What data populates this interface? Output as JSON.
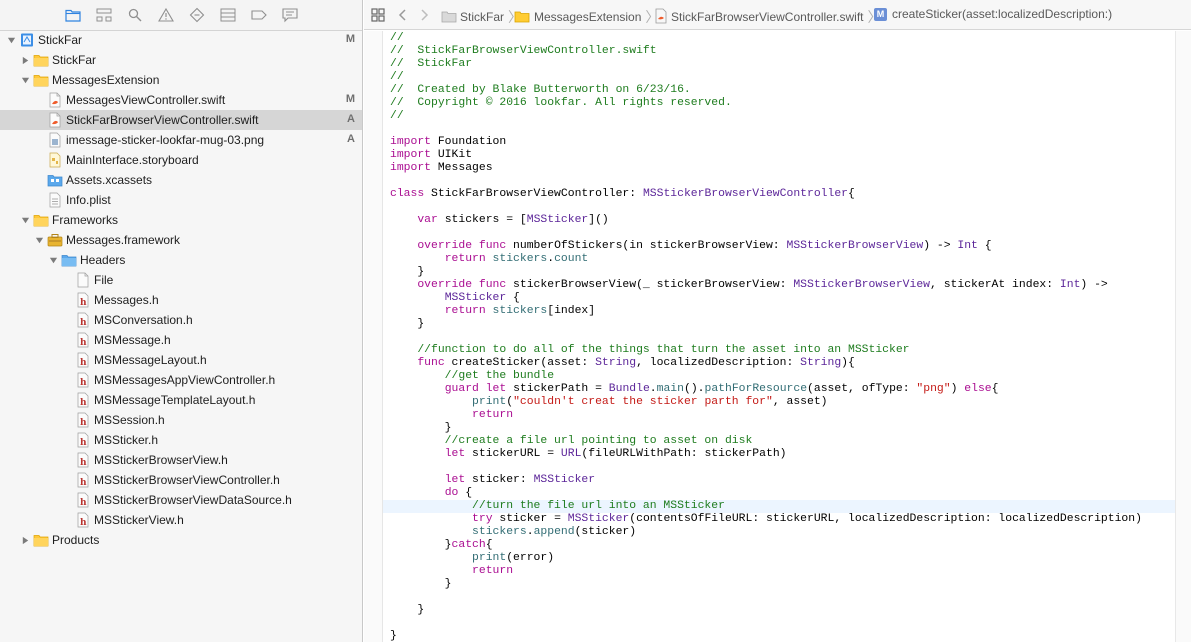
{
  "navigator": {
    "toolbar_icons": [
      "folder-icon",
      "hierarchy-icon",
      "search-icon",
      "warning-icon",
      "test-diamond-icon",
      "debug-grid-icon",
      "breakpoint-icon",
      "report-icon"
    ],
    "tree": [
      {
        "label": "StickFar",
        "badge": "M",
        "icon": "project-icon",
        "indent": 0,
        "disclosure": "open"
      },
      {
        "label": "StickFar",
        "badge": "",
        "icon": "folder-icon",
        "indent": 1,
        "disclosure": "closed"
      },
      {
        "label": "MessagesExtension",
        "badge": "",
        "icon": "folder-icon",
        "indent": 1,
        "disclosure": "open"
      },
      {
        "label": "MessagesViewController.swift",
        "badge": "M",
        "icon": "swift-file-icon",
        "indent": 2,
        "disclosure": ""
      },
      {
        "label": "StickFarBrowserViewController.swift",
        "badge": "A",
        "icon": "swift-file-icon",
        "indent": 2,
        "disclosure": "",
        "selected": true
      },
      {
        "label": "imessage-sticker-lookfar-mug-03.png",
        "badge": "A",
        "icon": "image-file-icon",
        "indent": 2,
        "disclosure": ""
      },
      {
        "label": "MainInterface.storyboard",
        "badge": "",
        "icon": "storyboard-icon",
        "indent": 2,
        "disclosure": ""
      },
      {
        "label": "Assets.xcassets",
        "badge": "",
        "icon": "assets-folder-icon",
        "indent": 2,
        "disclosure": ""
      },
      {
        "label": "Info.plist",
        "badge": "",
        "icon": "plist-file-icon",
        "indent": 2,
        "disclosure": ""
      },
      {
        "label": "Frameworks",
        "badge": "",
        "icon": "folder-icon",
        "indent": 1,
        "disclosure": "open"
      },
      {
        "label": "Messages.framework",
        "badge": "",
        "icon": "framework-icon",
        "indent": 2,
        "disclosure": "open"
      },
      {
        "label": "Headers",
        "badge": "",
        "icon": "blue-folder-icon",
        "indent": 3,
        "disclosure": "open"
      },
      {
        "label": "File",
        "badge": "",
        "icon": "blank-file-icon",
        "indent": 4,
        "disclosure": ""
      },
      {
        "label": "Messages.h",
        "badge": "",
        "icon": "header-file-icon",
        "indent": 4,
        "disclosure": ""
      },
      {
        "label": "MSConversation.h",
        "badge": "",
        "icon": "header-file-icon",
        "indent": 4,
        "disclosure": ""
      },
      {
        "label": "MSMessage.h",
        "badge": "",
        "icon": "header-file-icon",
        "indent": 4,
        "disclosure": ""
      },
      {
        "label": "MSMessageLayout.h",
        "badge": "",
        "icon": "header-file-icon",
        "indent": 4,
        "disclosure": ""
      },
      {
        "label": "MSMessagesAppViewController.h",
        "badge": "",
        "icon": "header-file-icon",
        "indent": 4,
        "disclosure": ""
      },
      {
        "label": "MSMessageTemplateLayout.h",
        "badge": "",
        "icon": "header-file-icon",
        "indent": 4,
        "disclosure": ""
      },
      {
        "label": "MSSession.h",
        "badge": "",
        "icon": "header-file-icon",
        "indent": 4,
        "disclosure": ""
      },
      {
        "label": "MSSticker.h",
        "badge": "",
        "icon": "header-file-icon",
        "indent": 4,
        "disclosure": ""
      },
      {
        "label": "MSStickerBrowserView.h",
        "badge": "",
        "icon": "header-file-icon",
        "indent": 4,
        "disclosure": ""
      },
      {
        "label": "MSStickerBrowserViewController.h",
        "badge": "",
        "icon": "header-file-icon",
        "indent": 4,
        "disclosure": ""
      },
      {
        "label": "MSStickerBrowserViewDataSource.h",
        "badge": "",
        "icon": "header-file-icon",
        "indent": 4,
        "disclosure": ""
      },
      {
        "label": "MSStickerView.h",
        "badge": "",
        "icon": "header-file-icon",
        "indent": 4,
        "disclosure": ""
      },
      {
        "label": "Products",
        "badge": "",
        "icon": "folder-icon",
        "indent": 1,
        "disclosure": "closed"
      }
    ]
  },
  "jump_bar": {
    "crumbs": [
      "StickFar",
      "MessagesExtension",
      "StickFarBrowserViewController.swift",
      "createSticker(asset:localizedDescription:)"
    ],
    "method_badge": "M"
  },
  "code": {
    "current_line_index": 36,
    "lines": [
      [
        [
          "//",
          "comment"
        ]
      ],
      [
        [
          "//  StickFarBrowserViewController.swift",
          "comment"
        ]
      ],
      [
        [
          "//  StickFar",
          "comment"
        ]
      ],
      [
        [
          "//",
          "comment"
        ]
      ],
      [
        [
          "//  Created by Blake Butterworth on 6/23/16.",
          "comment"
        ]
      ],
      [
        [
          "//  Copyright © 2016 lookfar. All rights reserved.",
          "comment"
        ]
      ],
      [
        [
          "//",
          "comment"
        ]
      ],
      [],
      [
        [
          "import",
          "kw"
        ],
        [
          " Foundation",
          "plain"
        ]
      ],
      [
        [
          "import",
          "kw"
        ],
        [
          " UIKit",
          "plain"
        ]
      ],
      [
        [
          "import",
          "kw"
        ],
        [
          " Messages",
          "plain"
        ]
      ],
      [],
      [
        [
          "class",
          "kw"
        ],
        [
          " StickFarBrowserViewController: ",
          "plain"
        ],
        [
          "MSStickerBrowserViewController",
          "type"
        ],
        [
          "{",
          "plain"
        ]
      ],
      [],
      [
        [
          "    ",
          "plain"
        ],
        [
          "var",
          "kw"
        ],
        [
          " stickers = [",
          "plain"
        ],
        [
          "MSSticker",
          "type"
        ],
        [
          "]()",
          "plain"
        ]
      ],
      [],
      [
        [
          "    ",
          "plain"
        ],
        [
          "override",
          "kw"
        ],
        [
          " ",
          "plain"
        ],
        [
          "func",
          "kw"
        ],
        [
          " numberOfStickers(in stickerBrowserView: ",
          "plain"
        ],
        [
          "MSStickerBrowserView",
          "type"
        ],
        [
          ") -> ",
          "plain"
        ],
        [
          "Int",
          "type"
        ],
        [
          " {",
          "plain"
        ]
      ],
      [
        [
          "        ",
          "plain"
        ],
        [
          "return",
          "kw"
        ],
        [
          " ",
          "plain"
        ],
        [
          "stickers",
          "func"
        ],
        [
          ".",
          "plain"
        ],
        [
          "count",
          "func"
        ]
      ],
      [
        [
          "    }",
          "plain"
        ]
      ],
      [
        [
          "    ",
          "plain"
        ],
        [
          "override",
          "kw"
        ],
        [
          " ",
          "plain"
        ],
        [
          "func",
          "kw"
        ],
        [
          " stickerBrowserView(_ stickerBrowserView: ",
          "plain"
        ],
        [
          "MSStickerBrowserView",
          "type"
        ],
        [
          ", stickerAt index: ",
          "plain"
        ],
        [
          "Int",
          "type"
        ],
        [
          ") ->",
          "plain"
        ]
      ],
      [
        [
          "        ",
          "plain"
        ],
        [
          "MSSticker",
          "type"
        ],
        [
          " {",
          "plain"
        ]
      ],
      [
        [
          "        ",
          "plain"
        ],
        [
          "return",
          "kw"
        ],
        [
          " ",
          "plain"
        ],
        [
          "stickers",
          "func"
        ],
        [
          "[index]",
          "plain"
        ]
      ],
      [
        [
          "    }",
          "plain"
        ]
      ],
      [],
      [
        [
          "    //function to do all of the things that turn the asset into an MSSticker",
          "comment"
        ]
      ],
      [
        [
          "    ",
          "plain"
        ],
        [
          "func",
          "kw"
        ],
        [
          " createSticker(asset: ",
          "plain"
        ],
        [
          "String",
          "type"
        ],
        [
          ", localizedDescription: ",
          "plain"
        ],
        [
          "String",
          "type"
        ],
        [
          "){",
          "plain"
        ]
      ],
      [
        [
          "        //get the bundle",
          "comment"
        ]
      ],
      [
        [
          "        ",
          "plain"
        ],
        [
          "guard",
          "kw"
        ],
        [
          " ",
          "plain"
        ],
        [
          "let",
          "kw"
        ],
        [
          " stickerPath = ",
          "plain"
        ],
        [
          "Bundle",
          "type"
        ],
        [
          ".",
          "plain"
        ],
        [
          "main",
          "func"
        ],
        [
          "().",
          "plain"
        ],
        [
          "pathForResource",
          "func"
        ],
        [
          "(asset, ofType: ",
          "plain"
        ],
        [
          "\"png\"",
          "str"
        ],
        [
          ") ",
          "plain"
        ],
        [
          "else",
          "kw"
        ],
        [
          "{",
          "plain"
        ]
      ],
      [
        [
          "            ",
          "plain"
        ],
        [
          "print",
          "func"
        ],
        [
          "(",
          "plain"
        ],
        [
          "\"couldn't creat the sticker parth for\"",
          "str"
        ],
        [
          ", asset)",
          "plain"
        ]
      ],
      [
        [
          "            ",
          "plain"
        ],
        [
          "return",
          "kw"
        ]
      ],
      [
        [
          "        }",
          "plain"
        ]
      ],
      [
        [
          "        //create a file url pointing to asset on disk",
          "comment"
        ]
      ],
      [
        [
          "        ",
          "plain"
        ],
        [
          "let",
          "kw"
        ],
        [
          " stickerURL = ",
          "plain"
        ],
        [
          "URL",
          "type"
        ],
        [
          "(fileURLWithPath: stickerPath)",
          "plain"
        ]
      ],
      [],
      [
        [
          "        ",
          "plain"
        ],
        [
          "let",
          "kw"
        ],
        [
          " sticker: ",
          "plain"
        ],
        [
          "MSSticker",
          "type"
        ]
      ],
      [
        [
          "        ",
          "plain"
        ],
        [
          "do",
          "kw"
        ],
        [
          " {",
          "plain"
        ]
      ],
      [
        [
          "            //turn the file url into an MSSticker",
          "comment"
        ]
      ],
      [
        [
          "            ",
          "plain"
        ],
        [
          "try",
          "kw"
        ],
        [
          " sticker = ",
          "plain"
        ],
        [
          "MSSticker",
          "type"
        ],
        [
          "(contentsOfFileURL: stickerURL, localizedDescription: localizedDescription)",
          "plain"
        ]
      ],
      [
        [
          "            ",
          "plain"
        ],
        [
          "stickers",
          "func"
        ],
        [
          ".",
          "plain"
        ],
        [
          "append",
          "func"
        ],
        [
          "(sticker)",
          "plain"
        ]
      ],
      [
        [
          "        }",
          "plain"
        ],
        [
          "catch",
          "kw"
        ],
        [
          "{",
          "plain"
        ]
      ],
      [
        [
          "            ",
          "plain"
        ],
        [
          "print",
          "func"
        ],
        [
          "(error)",
          "plain"
        ]
      ],
      [
        [
          "            ",
          "plain"
        ],
        [
          "return",
          "kw"
        ]
      ],
      [
        [
          "        }",
          "plain"
        ]
      ],
      [],
      [
        [
          "    }",
          "plain"
        ]
      ],
      [],
      [
        [
          "}",
          "plain"
        ]
      ]
    ]
  },
  "colors": {
    "comment": "#1e7c1e",
    "keyword": "#aa0d91",
    "type": "#5c2699",
    "string": "#c41a16",
    "function": "#326d74",
    "selection": "#d6d6d6",
    "current_line": "#ecf5ff"
  }
}
